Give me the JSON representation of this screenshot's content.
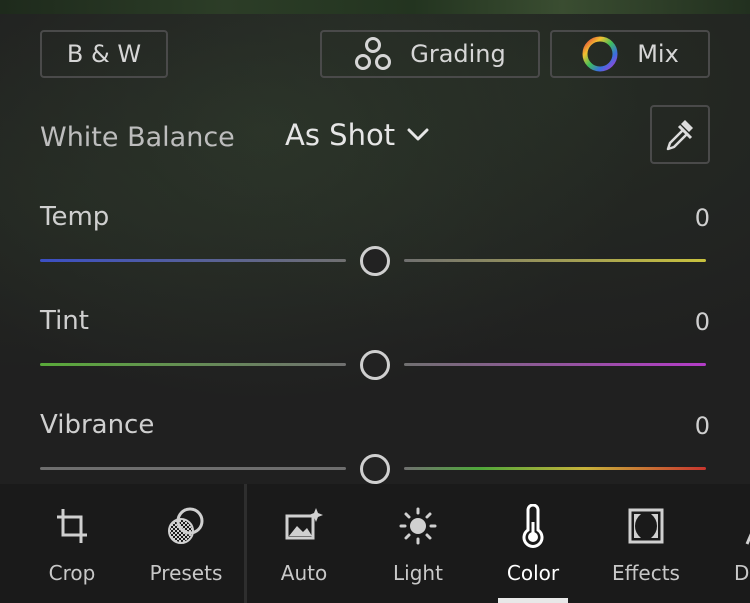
{
  "top_buttons": {
    "bw_label": "B & W",
    "grading_label": "Grading",
    "mix_label": "Mix"
  },
  "white_balance": {
    "label": "White Balance",
    "selected": "As Shot"
  },
  "sliders": [
    {
      "name": "Temp",
      "value": "0",
      "fraction": 0.5
    },
    {
      "name": "Tint",
      "value": "0",
      "fraction": 0.5
    },
    {
      "name": "Vibrance",
      "value": "0",
      "fraction": 0.5
    }
  ],
  "toolbar": [
    {
      "label": "Crop",
      "icon": "crop-icon"
    },
    {
      "label": "Presets",
      "icon": "presets-icon"
    },
    {
      "label": "Auto",
      "icon": "auto-icon"
    },
    {
      "label": "Light",
      "icon": "light-icon"
    },
    {
      "label": "Color",
      "icon": "color-icon",
      "active": true
    },
    {
      "label": "Effects",
      "icon": "effects-icon"
    },
    {
      "label": "De",
      "icon": "detail-icon"
    }
  ],
  "colors": {
    "temp_left": "#3b4fc4",
    "temp_right": "#c9c23e",
    "tint_left": "#5aaa3a",
    "tint_right": "#b43cc8",
    "vibrance_left": "#777777",
    "vibrance_right": "#c8352e"
  }
}
